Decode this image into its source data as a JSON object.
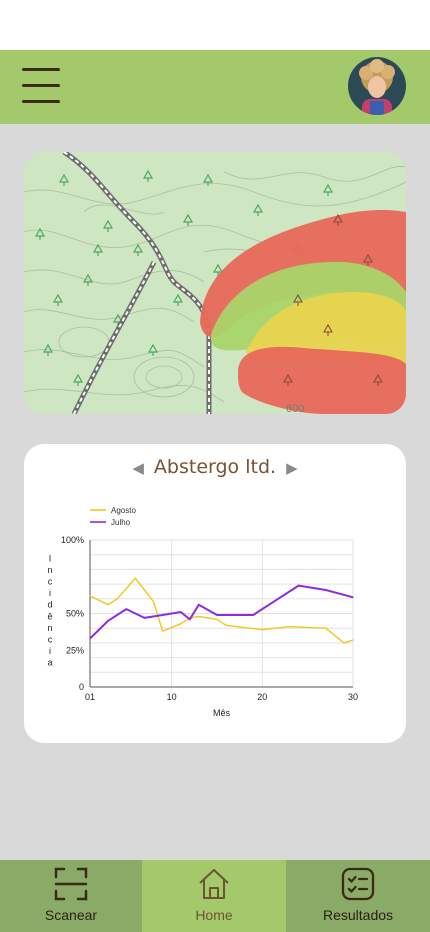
{
  "header": {
    "menu_icon": "hamburger-menu-icon",
    "avatar_icon": "user-avatar"
  },
  "map": {
    "elevation_label": "600"
  },
  "company": {
    "name": "Abstergo ltd.",
    "prev_icon": "triangle-left-icon",
    "next_icon": "triangle-right-icon"
  },
  "chart_data": {
    "type": "line",
    "xlabel": "Mês",
    "ylabel": "Incidência",
    "xticks": [
      "01",
      "10",
      "20",
      "30"
    ],
    "yticks": [
      "0",
      "25%",
      "50%",
      "100%"
    ],
    "xlim": [
      1,
      30
    ],
    "legend_position": "top-left",
    "series": [
      {
        "name": "Agosto",
        "color": "#f5c518",
        "x": [
          1,
          3,
          4,
          6,
          8,
          9,
          11,
          12,
          13,
          15,
          16,
          20,
          23,
          27,
          29,
          30
        ],
        "y": [
          62,
          56,
          60,
          74,
          58,
          38,
          43,
          47,
          48,
          46,
          42,
          39,
          41,
          40,
          30,
          32
        ]
      },
      {
        "name": "Julho",
        "color": "#8b2be2",
        "x": [
          1,
          3,
          5,
          7,
          9,
          11,
          12,
          13,
          15,
          17,
          19,
          21,
          24,
          27,
          30
        ],
        "y": [
          33,
          45,
          53,
          47,
          49,
          51,
          46,
          56,
          49,
          49,
          49,
          57,
          69,
          66,
          61
        ]
      }
    ]
  },
  "nav": {
    "scan_label": "Scanear",
    "home_label": "Home",
    "results_label": "Resultados"
  },
  "colors": {
    "header": "#a3c96b",
    "nav": "#8aaa68",
    "nav_active": "#a3c96b",
    "background": "#d9d9d9"
  }
}
